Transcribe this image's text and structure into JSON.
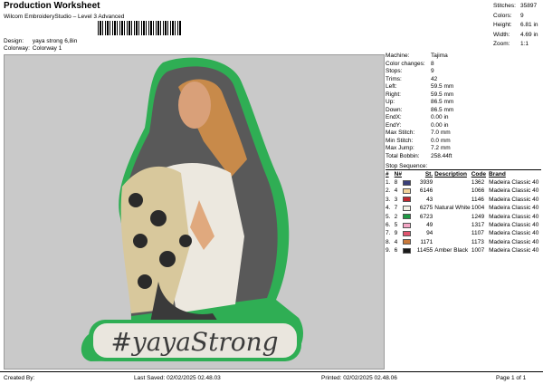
{
  "header": {
    "title": "Production Worksheet",
    "subtitle": "Wilcom EmbroideryStudio – Level 3 Advanced",
    "design_label": "Design:",
    "design_value": "yaya strong 6,8in",
    "colorway_label": "Colorway:",
    "colorway_value": "Colorway 1"
  },
  "stats": [
    {
      "label": "Stitches:",
      "value": "35897"
    },
    {
      "label": "Colors:",
      "value": "9"
    },
    {
      "label": "Height:",
      "value": "6.81 in"
    },
    {
      "label": "Width:",
      "value": "4.69 in"
    },
    {
      "label": "Zoom:",
      "value": "1:1"
    }
  ],
  "machine": [
    {
      "label": "Machine:",
      "value": "Tajima"
    },
    {
      "label": "Color changes:",
      "value": "8"
    },
    {
      "label": "Stops:",
      "value": "9"
    },
    {
      "label": "Trims:",
      "value": "42"
    },
    {
      "label": "Left:",
      "value": "59.5 mm"
    },
    {
      "label": "Right:",
      "value": "59.5 mm"
    },
    {
      "label": "Up:",
      "value": "86.5 mm"
    },
    {
      "label": "Down:",
      "value": "86.5 mm"
    },
    {
      "label": "EndX:",
      "value": "0.00 in"
    },
    {
      "label": "EndY:",
      "value": "0.00 in"
    },
    {
      "label": "Max Stitch:",
      "value": "7.0 mm"
    },
    {
      "label": "Min Stitch:",
      "value": "0.0 mm"
    },
    {
      "label": "Max Jump:",
      "value": "7.2 mm"
    },
    {
      "label": "Total Bobbin:",
      "value": "258.44ft"
    }
  ],
  "stop_sequence": {
    "title": "Stop Sequence:",
    "columns": [
      "#",
      "N#",
      "St.",
      "Description",
      "Code",
      "Brand"
    ],
    "rows": [
      {
        "idx": "1.",
        "n": "8",
        "color": "#3a3f7a",
        "st": "3939",
        "desc": "",
        "code": "1362",
        "brand": "Madeira Classic 40"
      },
      {
        "idx": "2.",
        "n": "4",
        "color": "#f3d39a",
        "st": "6146",
        "desc": "",
        "code": "1066",
        "brand": "Madeira Classic 40"
      },
      {
        "idx": "3.",
        "n": "3",
        "color": "#c0282f",
        "st": "43",
        "desc": "",
        "code": "1146",
        "brand": "Madeira Classic 40"
      },
      {
        "idx": "4.",
        "n": "7",
        "color": "#f4f1e6",
        "st": "6275",
        "desc": "Natural White",
        "code": "1004",
        "brand": "Madeira Classic 40"
      },
      {
        "idx": "5.",
        "n": "2",
        "color": "#1f9a45",
        "st": "6723",
        "desc": "",
        "code": "1249",
        "brand": "Madeira Classic 40"
      },
      {
        "idx": "6.",
        "n": "5",
        "color": "#f3a6c5",
        "st": "49",
        "desc": "",
        "code": "1317",
        "brand": "Madeira Classic 40"
      },
      {
        "idx": "7.",
        "n": "9",
        "color": "#e0546e",
        "st": "94",
        "desc": "",
        "code": "1107",
        "brand": "Madeira Classic 40"
      },
      {
        "idx": "8.",
        "n": "4",
        "color": "#c8793b",
        "st": "1171",
        "desc": "",
        "code": "1173",
        "brand": "Madeira Classic 40"
      },
      {
        "idx": "9.",
        "n": "6",
        "color": "#1a1a1a",
        "st": "11455",
        "desc": "Amber Black",
        "code": "1007",
        "brand": "Madeira Classic 40"
      }
    ]
  },
  "design_text": "#yayaStrong",
  "footer": {
    "created_by": "Created By:",
    "last_saved": "Last Saved: 02/02/2025 02.48.03",
    "printed": "Printed: 02/02/2025 02.48.06",
    "page": "Page 1 of 1"
  }
}
